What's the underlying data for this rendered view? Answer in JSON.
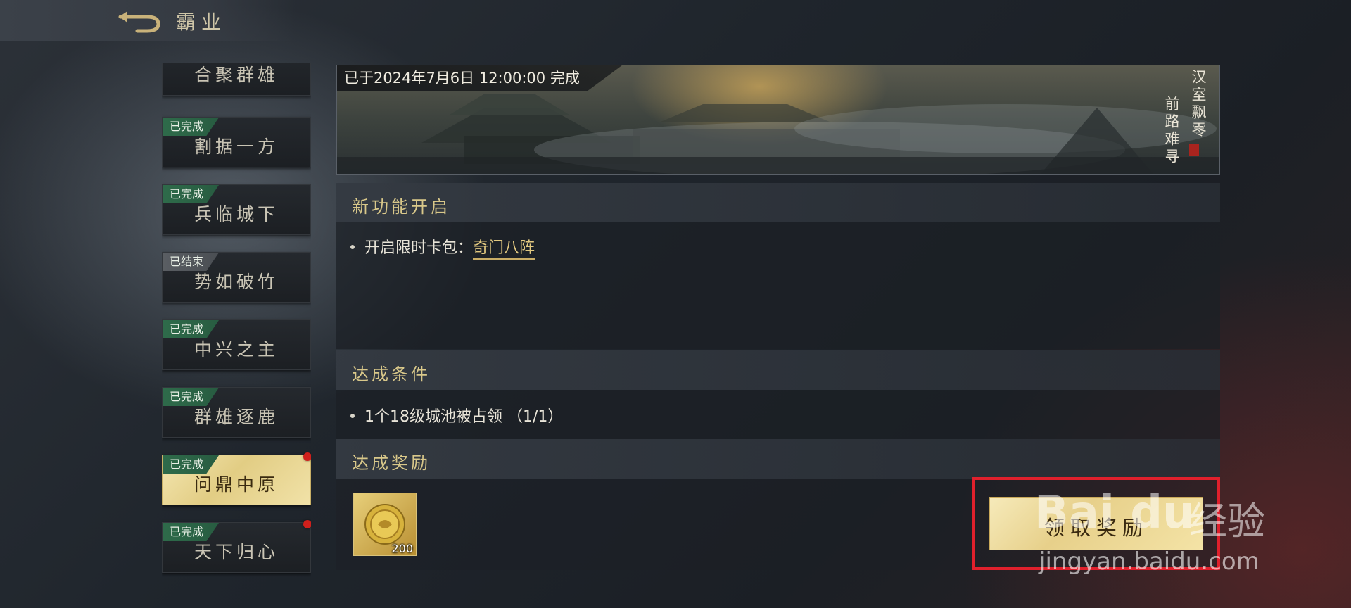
{
  "header": {
    "title": "霸业"
  },
  "sidebar": {
    "items": [
      {
        "label": "合聚群雄",
        "badge": ""
      },
      {
        "label": "割据一方",
        "badge": "已完成"
      },
      {
        "label": "兵临城下",
        "badge": "已完成"
      },
      {
        "label": "势如破竹",
        "badge": "已结束"
      },
      {
        "label": "中兴之主",
        "badge": "已完成"
      },
      {
        "label": "群雄逐鹿",
        "badge": "已完成"
      },
      {
        "label": "问鼎中原",
        "badge": "已完成"
      },
      {
        "label": "天下归心",
        "badge": "已完成"
      }
    ]
  },
  "banner": {
    "date_text": "已于2024年7月6日 12:00:00 完成",
    "poem_line1": "汉室飘零",
    "poem_line2": "前路难寻"
  },
  "new_feature": {
    "title": "新功能开启",
    "line_prefix": "开启限时卡包：",
    "link_text": "奇门八阵"
  },
  "condition": {
    "title": "达成条件",
    "line": "1个18级城池被占领 （1/1）"
  },
  "reward": {
    "title": "达成奖励",
    "item_count": "200",
    "claim_label": "领取奖励"
  },
  "watermark": {
    "logo": "Bai du",
    "text": "经验",
    "url": "jingyan.baidu.com"
  },
  "colors": {
    "accent_gold": "#e2c980",
    "completed_green": "#2e6b4a",
    "notify_red": "#d0201c",
    "highlight_red": "#e0202c"
  }
}
